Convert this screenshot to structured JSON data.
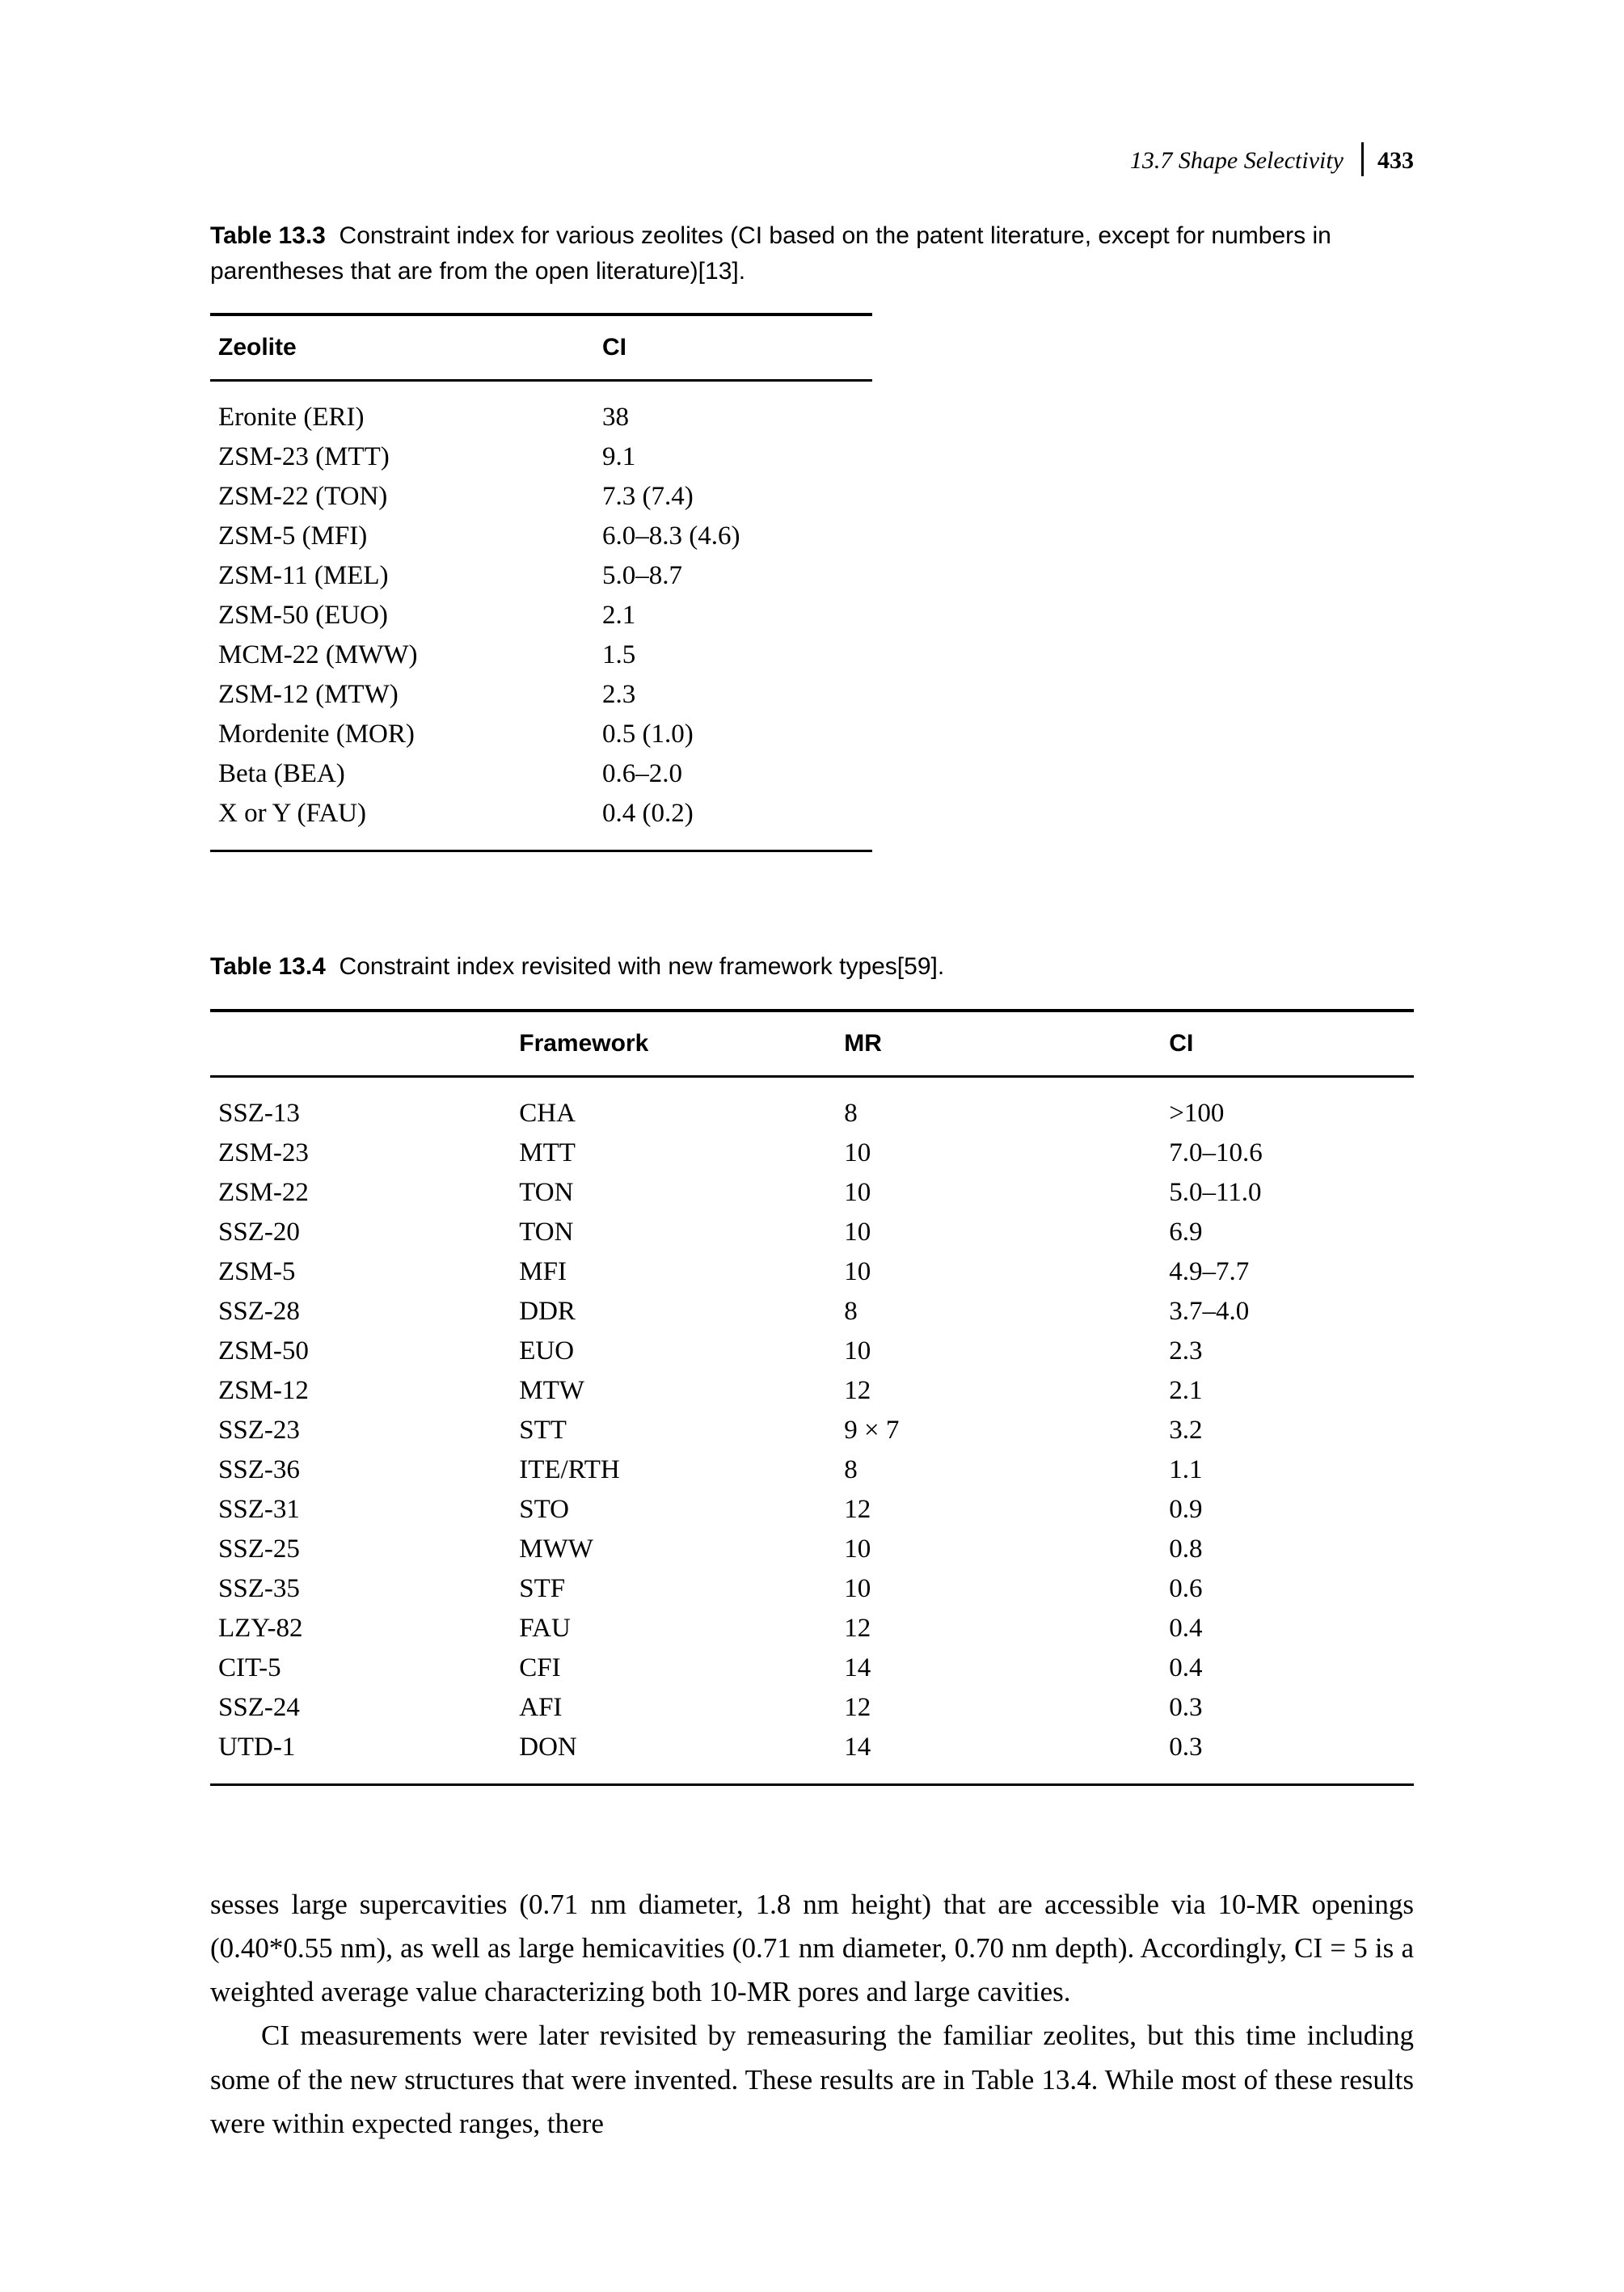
{
  "header": {
    "section": "13.7 Shape Selectivity",
    "page": "433"
  },
  "table133": {
    "caption_label": "Table 13.3",
    "caption_text": "Constraint index for various zeolites (CI based on the patent literature, except for numbers in parentheses that are from the open literature)[13].",
    "head": {
      "c0": "Zeolite",
      "c1": "CI"
    },
    "rows": [
      {
        "c0": "Eronite (ERI)",
        "c1": "38"
      },
      {
        "c0": "ZSM-23 (MTT)",
        "c1": "9.1"
      },
      {
        "c0": "ZSM-22 (TON)",
        "c1": "7.3 (7.4)"
      },
      {
        "c0": "ZSM-5 (MFI)",
        "c1": "6.0–8.3 (4.6)"
      },
      {
        "c0": "ZSM-11 (MEL)",
        "c1": "5.0–8.7"
      },
      {
        "c0": "ZSM-50 (EUO)",
        "c1": "2.1"
      },
      {
        "c0": "MCM-22 (MWW)",
        "c1": "1.5"
      },
      {
        "c0": "ZSM-12 (MTW)",
        "c1": "2.3"
      },
      {
        "c0": "Mordenite (MOR)",
        "c1": "0.5 (1.0)"
      },
      {
        "c0": "Beta (BEA)",
        "c1": "0.6–2.0"
      },
      {
        "c0": "X or Y (FAU)",
        "c1": "0.4 (0.2)"
      }
    ]
  },
  "table134": {
    "caption_label": "Table 13.4",
    "caption_text": "Constraint index revisited with new framework types[59].",
    "head": {
      "c0": "",
      "c1": "Framework",
      "c2": "MR",
      "c3": "CI"
    },
    "rows": [
      {
        "c0": "SSZ-13",
        "c1": "CHA",
        "c2": "8",
        "c3": ">100"
      },
      {
        "c0": "ZSM-23",
        "c1": "MTT",
        "c2": "10",
        "c3": "7.0–10.6"
      },
      {
        "c0": "ZSM-22",
        "c1": "TON",
        "c2": "10",
        "c3": "5.0–11.0"
      },
      {
        "c0": "SSZ-20",
        "c1": "TON",
        "c2": "10",
        "c3": "6.9"
      },
      {
        "c0": "ZSM-5",
        "c1": "MFI",
        "c2": "10",
        "c3": "4.9–7.7"
      },
      {
        "c0": "SSZ-28",
        "c1": "DDR",
        "c2": "8",
        "c3": "3.7–4.0"
      },
      {
        "c0": "ZSM-50",
        "c1": "EUO",
        "c2": "10",
        "c3": "2.3"
      },
      {
        "c0": "ZSM-12",
        "c1": "MTW",
        "c2": "12",
        "c3": "2.1"
      },
      {
        "c0": "SSZ-23",
        "c1": "STT",
        "c2": "9 × 7",
        "c3": "3.2"
      },
      {
        "c0": "SSZ-36",
        "c1": "ITE/RTH",
        "c2": "8",
        "c3": "1.1"
      },
      {
        "c0": "SSZ-31",
        "c1": "STO",
        "c2": "12",
        "c3": "0.9"
      },
      {
        "c0": "SSZ-25",
        "c1": "MWW",
        "c2": "10",
        "c3": "0.8"
      },
      {
        "c0": "SSZ-35",
        "c1": "STF",
        "c2": "10",
        "c3": "0.6"
      },
      {
        "c0": "LZY-82",
        "c1": "FAU",
        "c2": "12",
        "c3": "0.4"
      },
      {
        "c0": "CIT-5",
        "c1": "CFI",
        "c2": "14",
        "c3": "0.4"
      },
      {
        "c0": "SSZ-24",
        "c1": "AFI",
        "c2": "12",
        "c3": "0.3"
      },
      {
        "c0": "UTD-1",
        "c1": "DON",
        "c2": "14",
        "c3": "0.3"
      }
    ]
  },
  "body": {
    "p1": "sesses large supercavities (0.71 nm diameter, 1.8 nm height) that are accessible via 10-MR openings (0.40*0.55 nm), as well as large hemicavities (0.71 nm diameter, 0.70 nm depth). Accordingly, CI = 5 is a weighted average value characterizing both 10-MR pores and large cavities.",
    "p2": "CI measurements were later revisited by remeasuring the familiar zeolites, but this time including some of the new structures that were invented. These results are in Table 13.4. While most of these results were within expected ranges, there"
  }
}
